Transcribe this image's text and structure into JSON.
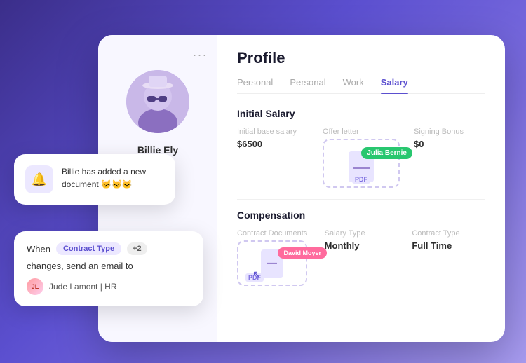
{
  "app": {
    "title": "Profile",
    "background": "#5b4fcf"
  },
  "sidebar": {
    "dots": "...",
    "user": {
      "name": "Billie Ely"
    }
  },
  "tabs": [
    {
      "label": "Personal",
      "active": false
    },
    {
      "label": "Personal",
      "active": false
    },
    {
      "label": "Work",
      "active": false
    },
    {
      "label": "Salary",
      "active": true
    }
  ],
  "initial_salary_section": {
    "title": "Initial Salary",
    "fields": [
      {
        "label": "Initial base salary",
        "value": "$6500"
      },
      {
        "label": "Offer letter",
        "value": ""
      },
      {
        "label": "Signing Bonus",
        "value": "$0"
      }
    ],
    "offer_letter": {
      "name_tag": "Julia Bernie",
      "pdf_label": "PDF"
    }
  },
  "compensation_section": {
    "title": "Compensation",
    "fields": [
      {
        "label": "Contract Documents",
        "value": ""
      },
      {
        "label": "Salary Type",
        "value": "Monthly"
      },
      {
        "label": "Contract Type",
        "value": "Full Time"
      }
    ],
    "contract_doc": {
      "name_tag": "David Moyer",
      "pdf_label": "PDF"
    }
  },
  "notification": {
    "icon": "🔔",
    "text": "Billie has added a new document 🐱🐱🐱"
  },
  "workflow": {
    "when_label": "When",
    "badge": "Contract Type",
    "count_badge": "+2",
    "line2": "changes, send an email to",
    "user": {
      "initials": "JL",
      "name": "Jude Lamont | HR"
    }
  }
}
